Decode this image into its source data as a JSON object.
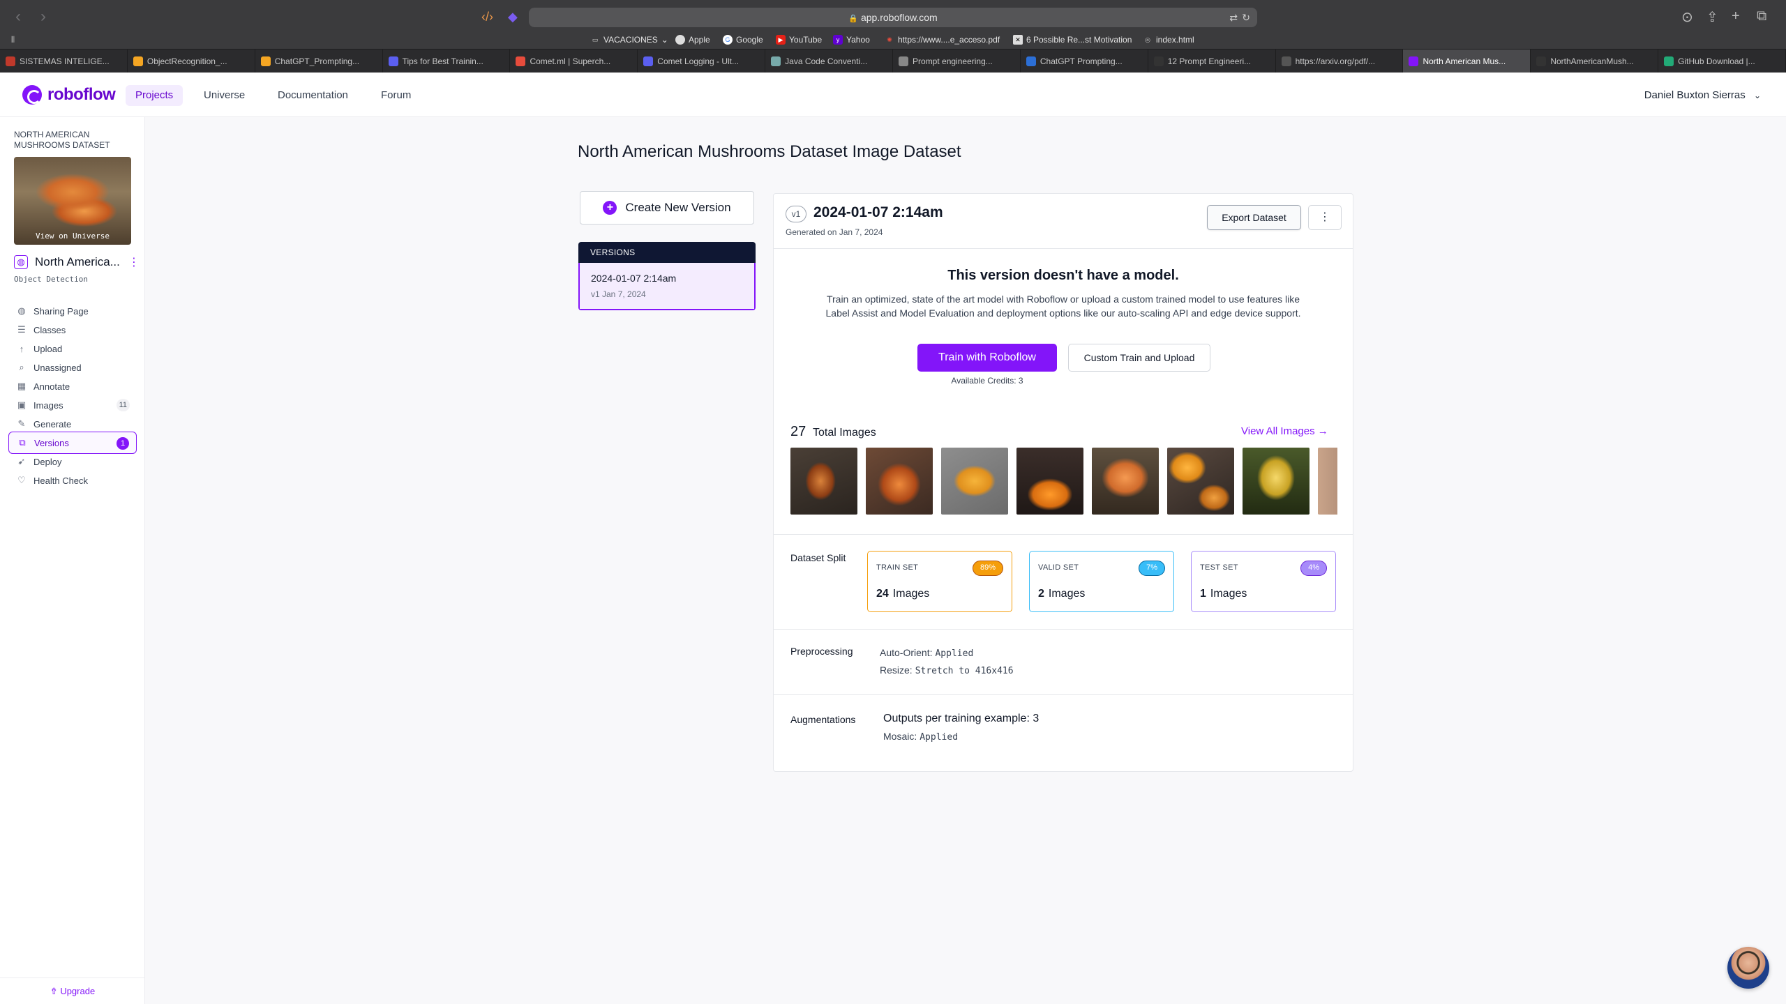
{
  "browser": {
    "url": "app.roboflow.com",
    "favorites": [
      {
        "label": "VACACIONES",
        "icon": "folder-icon"
      },
      {
        "label": "Apple",
        "icon": "apple-icon"
      },
      {
        "label": "Google",
        "icon": "google-icon"
      },
      {
        "label": "YouTube",
        "icon": "youtube-icon"
      },
      {
        "label": "Yahoo",
        "icon": "yahoo-icon"
      },
      {
        "label": "https://www....e_acceso.pdf",
        "icon": "pdf-icon"
      },
      {
        "label": "6 Possible Re...st Motivation",
        "icon": "x-icon"
      },
      {
        "label": "index.html",
        "icon": "globe-icon"
      }
    ],
    "tabs": [
      {
        "label": "SISTEMAS INTELIGE...",
        "color": "#c0392b"
      },
      {
        "label": "ObjectRecognition_...",
        "color": "#f5a623"
      },
      {
        "label": "ChatGPT_Prompting...",
        "color": "#f5a623"
      },
      {
        "label": "Tips for Best Trainin...",
        "color": "#5b5ff0"
      },
      {
        "label": "Comet.ml | Superch...",
        "color": "#e74c3c"
      },
      {
        "label": "Comet Logging - Ult...",
        "color": "#5b5ff0"
      },
      {
        "label": "Java Code Conventi...",
        "color": "#7aa"
      },
      {
        "label": "Prompt engineering...",
        "color": "#888"
      },
      {
        "label": "ChatGPT Prompting...",
        "color": "#2c6fd6"
      },
      {
        "label": "12 Prompt Engineeri...",
        "color": "#333"
      },
      {
        "label": "https://arxiv.org/pdf/...",
        "color": "#555"
      },
      {
        "label": "North American Mus...",
        "color": "#8315f9"
      },
      {
        "label": "NorthAmericanMush...",
        "color": "#333"
      },
      {
        "label": "GitHub Download |...",
        "color": "#2a7"
      }
    ],
    "active_tab_index": 11
  },
  "header": {
    "logo_text": "roboflow",
    "nav": [
      "Projects",
      "Universe",
      "Documentation",
      "Forum"
    ],
    "active_nav": "Projects",
    "user_name": "Daniel Buxton Sierras"
  },
  "sidebar": {
    "dataset_name": "NORTH AMERICAN MUSHROOMS DATASET",
    "thumb_label": "View on Universe",
    "project_name": "North America...",
    "project_type": "Object Detection",
    "items": [
      {
        "label": "Sharing Page",
        "icon": "globe-icon",
        "badge": ""
      },
      {
        "label": "Classes",
        "icon": "list-icon",
        "badge": ""
      },
      {
        "label": "Upload",
        "icon": "upload-arrow-icon",
        "badge": ""
      },
      {
        "label": "Unassigned",
        "icon": "search-icon",
        "badge": ""
      },
      {
        "label": "Annotate",
        "icon": "annotate-icon",
        "badge": ""
      },
      {
        "label": "Images",
        "icon": "image-icon",
        "badge": "11"
      },
      {
        "label": "Generate",
        "icon": "generate-icon",
        "badge": ""
      },
      {
        "label": "Versions",
        "icon": "versions-icon",
        "badge": "1"
      },
      {
        "label": "Deploy",
        "icon": "rocket-icon",
        "badge": ""
      },
      {
        "label": "Health Check",
        "icon": "heart-icon",
        "badge": ""
      }
    ],
    "active_item": "Versions",
    "upgrade_label": "Upgrade"
  },
  "main": {
    "title": "North American Mushrooms Dataset Image Dataset",
    "create_version_label": "Create New Version",
    "versions_header": "VERSIONS",
    "versions": [
      {
        "title": "2024-01-07 2:14am",
        "sub": "v1 Jan 7, 2024"
      }
    ]
  },
  "version": {
    "badge": "v1",
    "title": "2024-01-07 2:14am",
    "generated": "Generated on Jan 7, 2024",
    "export_label": "Export Dataset",
    "no_model_title": "This version doesn't have a model.",
    "no_model_desc": "Train an optimized, state of the art model with Roboflow or upload a custom trained model to use features like Label Assist and Model Evaluation and deployment options like our auto-scaling API and edge device support.",
    "train_label": "Train with Roboflow",
    "custom_train_label": "Custom Train and Upload",
    "credits": "Available Credits:  3",
    "total_images": "27",
    "total_images_label": "Total Images",
    "view_all_label": "View All Images",
    "split_label": "Dataset Split",
    "splits": [
      {
        "name": "TRAIN SET",
        "pct": "89%",
        "count": "24",
        "unit": "Images"
      },
      {
        "name": "VALID SET",
        "pct": "7%",
        "count": "2",
        "unit": "Images"
      },
      {
        "name": "TEST SET",
        "pct": "4%",
        "count": "1",
        "unit": "Images"
      }
    ],
    "preprocessing_label": "Preprocessing",
    "preprocessing": [
      {
        "key": "Auto-Orient:",
        "value": "Applied"
      },
      {
        "key": "Resize:",
        "value": "Stretch to 416x416"
      }
    ],
    "augmentations_label": "Augmentations",
    "augmentations_outputs": "Outputs per training example: 3",
    "augmentations": [
      {
        "key": "Mosaic:",
        "value": "Applied"
      }
    ]
  },
  "colors": {
    "brand": "#8315f9",
    "train": "#f59e0b",
    "valid": "#38bdf8",
    "test": "#a78bfa"
  }
}
